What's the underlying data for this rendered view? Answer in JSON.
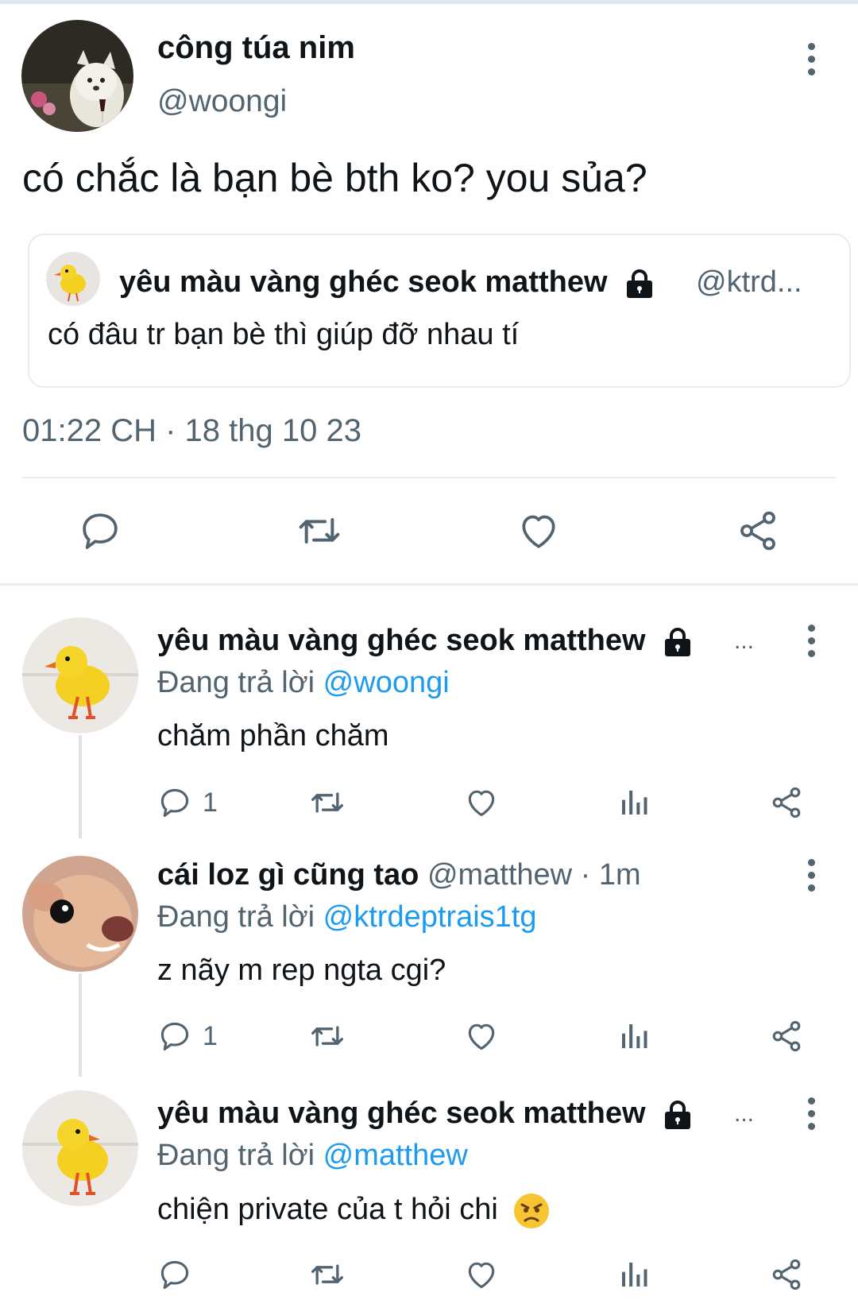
{
  "main_tweet": {
    "author_name": "công túa nim",
    "author_handle": "@woongi",
    "text": "có chắc là bạn bè bth ko? you sủa?",
    "quoted": {
      "author_name": "yêu màu vàng ghéc seok matthew",
      "author_handle": "@ktrd...",
      "text": "có đâu tr bạn bè thì giúp đỡ nhau tí"
    },
    "timestamp": "01:22 CH · 18 thg 10 23",
    "actions": [
      "reply-icon",
      "retweet-icon",
      "like-icon",
      "share-icon"
    ]
  },
  "replies": [
    {
      "author_name": "yêu màu vàng ghéc seok matthew",
      "author_handle": "",
      "more": "...",
      "time": "",
      "replying_prefix": "Đang trả lời ",
      "replying_to": "@woongi",
      "text": "chăm phần chăm",
      "reply_count": "1"
    },
    {
      "author_name": "cái loz gì cũng tao",
      "author_handle": "@matthew · 1m",
      "more": "",
      "replying_prefix": "Đang trả lời ",
      "replying_to": "@ktrdeptrais1tg",
      "text": "z nãy m rep ngta cgi?",
      "reply_count": "1"
    },
    {
      "author_name": "yêu màu vàng ghéc seok matthew",
      "author_handle": "",
      "more": "...",
      "replying_prefix": "Đang trả lời ",
      "replying_to": "@matthew",
      "text": "chiện private của t hỏi chi",
      "emoji": "😠",
      "reply_count": ""
    }
  ],
  "colors": {
    "text": "#0f1419",
    "secondary": "#536471",
    "accent": "#1d9bf0",
    "divider": "#e6ecf0"
  }
}
